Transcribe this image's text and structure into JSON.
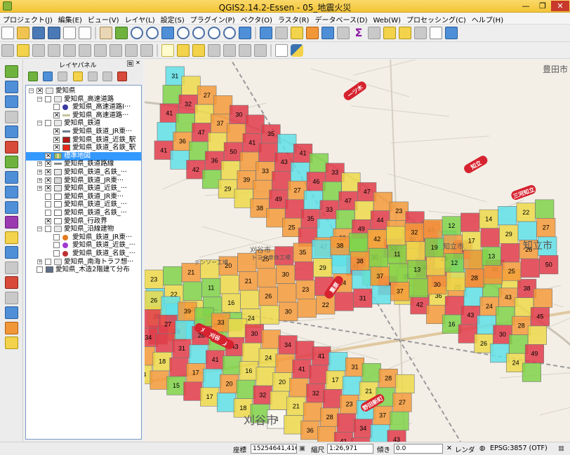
{
  "window": {
    "title": "QGIS2.14.2-Essen - 05_地震火災",
    "minimize": "—",
    "maximize": "❐",
    "close": "✕"
  },
  "menu": [
    "プロジェクト(J)",
    "編集(E)",
    "ビュー(V)",
    "レイヤ(L)",
    "設定(S)",
    "プラグイン(P)",
    "ベクタ(O)",
    "ラスタ(R)",
    "データベース(D)",
    "Web(W)",
    "プロセッシング(C)",
    "ヘルプ(H)"
  ],
  "layer_panel": {
    "title": "レイヤパネル",
    "float_glyph": "⧉",
    "close_glyph": "✕"
  },
  "layers": [
    {
      "label": "愛知県",
      "expand": "−",
      "checked": true
    },
    {
      "label": "愛知県_高速道路",
      "expand": "−",
      "checked": false
    },
    {
      "label": "愛知県_高速道路I···",
      "checked": false
    },
    {
      "label": "愛知県_高速道路···",
      "checked": true
    },
    {
      "label": "愛知県_鉄道",
      "expand": "−",
      "checked": false
    },
    {
      "label": "愛知県_鉄道_JR東···",
      "checked": true
    },
    {
      "label": "愛知県_鉄道_近鉄_駅",
      "checked": true
    },
    {
      "label": "愛知県_鉄道_名鉄_駅",
      "checked": true
    },
    {
      "label": "標準地図",
      "checked": true
    },
    {
      "label": "愛知県_鉄道路線",
      "expand": "+",
      "checked": true
    },
    {
      "label": "愛知県_鉄道_名鉄_···",
      "expand": "+",
      "checked": true
    },
    {
      "label": "愛知県_鉄道_JR東···",
      "expand": "+",
      "checked": true
    },
    {
      "label": "愛知県_鉄道_近鉄_···",
      "expand": "+",
      "checked": true
    },
    {
      "label": "愛知県_鉄道_JR東···",
      "checked": false
    },
    {
      "label": "愛知県_鉄道_近鉄_···",
      "checked": false
    },
    {
      "label": "愛知県_鉄道_名鉄_···",
      "checked": false
    },
    {
      "label": "愛知県_行政界",
      "checked": true
    },
    {
      "label": "愛知県_沿線建物",
      "expand": "−",
      "checked": false
    },
    {
      "label": "愛知県_鉄道_JR東···",
      "checked": false
    },
    {
      "label": "愛知県_鉄道_近鉄_···",
      "checked": false
    },
    {
      "label": "愛知県_鉄道_名鉄_···",
      "checked": false
    },
    {
      "label": "愛知県_南海トラフ想···",
      "expand": "+",
      "checked": false
    },
    {
      "label": "愛知県_木造2階建て分布",
      "checked": false
    }
  ],
  "colors": {
    "selection": "#3399ff",
    "class_red": "#e03c4a",
    "class_orange": "#f39a3a",
    "class_yellow": "#ecd94a",
    "class_green": "#7fd24a",
    "class_cyan": "#5fe0e8",
    "class_white": "#f7f7f0"
  },
  "icons": {
    "toolbar": [
      "new-project-icon",
      "open-project-icon",
      "save-project-icon",
      "save-as-icon",
      "print-composer-icon",
      "composer-manager-icon",
      "pan-map-icon",
      "pan-to-selection-icon",
      "zoom-in-icon",
      "zoom-out-icon",
      "zoom-full-icon",
      "zoom-to-selection-icon",
      "zoom-to-layer-icon",
      "zoom-native-icon",
      "refresh-icon",
      "identify-icon",
      "measure-icon",
      "select-features-icon",
      "deselect-icon",
      "attribute-table-icon",
      "field-calculator-icon",
      "statistics-icon",
      "measure-line-icon",
      "map-tips-icon",
      "new-bookmark-icon",
      "show-bookmarks-icon",
      "text-annotation-icon",
      "help-icon"
    ],
    "toolbar2": [
      "digitize-icon",
      "edit-pencil-icon",
      "save-edits-icon",
      "add-feature-icon",
      "node-tool-icon",
      "move-feature-icon",
      "delete-selected-icon",
      "cut-features-icon",
      "copy-features-icon",
      "paste-features-icon",
      "label-abc-icon",
      "pin-labels-icon",
      "show-hide-labels-icon",
      "move-label-icon",
      "rotate-label-icon",
      "change-label-icon",
      "csw-icon",
      "python-console-icon"
    ],
    "left": [
      "add-vector-layer-icon",
      "add-raster-layer-icon",
      "add-postgis-layer-icon",
      "add-spatialite-layer-icon",
      "add-mssql-layer-icon",
      "add-oracle-layer-icon",
      "add-db2-layer-icon",
      "add-wms-layer-icon",
      "add-wcs-layer-icon",
      "add-wfs-layer-icon",
      "add-delimited-text-icon",
      "new-shapefile-icon",
      "new-spatialite-icon",
      "new-temporary-layer-icon",
      "gps-icon",
      "georeferencer-icon",
      "raster-calculator-icon",
      "heatmap-icon",
      "coordinate-capture-icon"
    ]
  },
  "map": {
    "place_labels": [
      "豊田市",
      "刈谷市",
      "知立市",
      "知立市",
      "刈谷市",
      "デンソー工場",
      "トヨタ車体工場"
    ],
    "station_labels": [
      "一ツ木",
      "知立",
      "三河知立",
      "重原",
      "刈谷",
      "刈谷",
      "刈谷",
      "野田新町"
    ],
    "numbered_cells": [
      {
        "v": "31",
        "c": "cyan"
      },
      {
        "v": "27",
        "c": "orange"
      },
      {
        "v": "30",
        "c": "red"
      },
      {
        "v": "35",
        "c": "red"
      },
      {
        "v": "41",
        "c": "red"
      },
      {
        "v": "33",
        "c": "red"
      },
      {
        "v": "47",
        "c": "red"
      },
      {
        "v": "23",
        "c": "orange"
      },
      {
        "v": "43",
        "c": "red"
      },
      {
        "v": "54",
        "c": "red"
      },
      {
        "v": "36",
        "c": "red"
      },
      {
        "v": "38",
        "c": "red"
      },
      {
        "v": "32",
        "c": "red"
      },
      {
        "v": "37",
        "c": "orange"
      },
      {
        "v": "41",
        "c": "red"
      },
      {
        "v": "43",
        "c": "red"
      },
      {
        "v": "46",
        "c": "red"
      },
      {
        "v": "47",
        "c": "red"
      },
      {
        "v": "44",
        "c": "red"
      },
      {
        "v": "30",
        "c": "orange"
      },
      {
        "v": "28",
        "c": "orange"
      },
      {
        "v": "32",
        "c": "red"
      },
      {
        "v": "43",
        "c": "orange"
      },
      {
        "v": "45",
        "c": "red"
      },
      {
        "v": "41",
        "c": "red"
      },
      {
        "v": "47",
        "c": "red"
      },
      {
        "v": "50",
        "c": "red"
      },
      {
        "v": "33",
        "c": "orange"
      },
      {
        "v": "27",
        "c": "orange"
      },
      {
        "v": "33",
        "c": "red"
      },
      {
        "v": "49",
        "c": "red"
      },
      {
        "v": "53",
        "c": "red"
      },
      {
        "v": "48",
        "c": "red"
      },
      {
        "v": "25",
        "c": "orange"
      },
      {
        "v": "24",
        "c": "orange"
      },
      {
        "v": "28",
        "c": "orange"
      },
      {
        "v": "36",
        "c": "orange"
      },
      {
        "v": "36",
        "c": "red"
      },
      {
        "v": "39",
        "c": "orange"
      },
      {
        "v": "49",
        "c": "red"
      },
      {
        "v": "35",
        "c": "red"
      },
      {
        "v": "29",
        "c": "orange"
      },
      {
        "v": "30",
        "c": "orange"
      },
      {
        "v": "35",
        "c": "yellow"
      },
      {
        "v": "36",
        "c": "yellow"
      },
      {
        "v": "43",
        "c": "red"
      },
      {
        "v": "30",
        "c": "red"
      },
      {
        "v": "49",
        "c": "red"
      },
      {
        "v": "41",
        "c": "red"
      },
      {
        "v": "42",
        "c": "red"
      },
      {
        "v": "29",
        "c": "yellow"
      },
      {
        "v": "38",
        "c": "orange"
      },
      {
        "v": "25",
        "c": "orange"
      },
      {
        "v": "47",
        "c": "orange"
      },
      {
        "v": "41",
        "c": "red"
      },
      {
        "v": "38",
        "c": "red"
      },
      {
        "v": "42",
        "c": "red"
      },
      {
        "v": "16",
        "c": "green"
      },
      {
        "v": "26",
        "c": "yellow"
      },
      {
        "v": "24",
        "c": "yellow"
      },
      {
        "v": "23",
        "c": "yellow"
      },
      {
        "v": "21",
        "c": "orange"
      },
      {
        "v": "20",
        "c": "orange"
      },
      {
        "v": "25",
        "c": "orange"
      },
      {
        "v": "35",
        "c": "orange"
      },
      {
        "v": "38",
        "c": "orange"
      },
      {
        "v": "42",
        "c": "orange"
      },
      {
        "v": "32",
        "c": "orange"
      },
      {
        "v": "12",
        "c": "green"
      },
      {
        "v": "14",
        "c": "yellow"
      },
      {
        "v": "22",
        "c": "yellow"
      },
      {
        "v": "22",
        "c": "yellow"
      },
      {
        "v": "11",
        "c": "green"
      },
      {
        "v": "21",
        "c": "orange"
      },
      {
        "v": "30",
        "c": "orange"
      },
      {
        "v": "29",
        "c": "yellow"
      },
      {
        "v": "38",
        "c": "orange"
      },
      {
        "v": "11",
        "c": "green"
      },
      {
        "v": "19",
        "c": "green"
      },
      {
        "v": "17",
        "c": "yellow"
      },
      {
        "v": "29",
        "c": "yellow"
      },
      {
        "v": "27",
        "c": "orange"
      },
      {
        "v": "20",
        "c": "yellow"
      },
      {
        "v": "24",
        "c": "yellow"
      },
      {
        "v": "16",
        "c": "yellow"
      },
      {
        "v": "26",
        "c": "orange"
      },
      {
        "v": "23",
        "c": "orange"
      },
      {
        "v": "24",
        "c": "orange"
      },
      {
        "v": "37",
        "c": "orange"
      },
      {
        "v": "13",
        "c": "green"
      },
      {
        "v": "12",
        "c": "green"
      },
      {
        "v": "13",
        "c": "green"
      },
      {
        "v": "26",
        "c": "orange"
      },
      {
        "v": "28",
        "c": "orange"
      },
      {
        "v": "26",
        "c": "orange"
      },
      {
        "v": "24",
        "c": "yellow"
      },
      {
        "v": "30",
        "c": "orange"
      },
      {
        "v": "22",
        "c": "orange"
      },
      {
        "v": "31",
        "c": "red"
      },
      {
        "v": "37",
        "c": "orange"
      },
      {
        "v": "30",
        "c": "orange"
      },
      {
        "v": "28",
        "c": "orange"
      },
      {
        "v": "25",
        "c": "orange"
      },
      {
        "v": "50",
        "c": "red"
      },
      {
        "v": "26",
        "c": "yellow"
      },
      {
        "v": "39",
        "c": "orange"
      },
      {
        "v": "33",
        "c": "orange"
      },
      {
        "v": "30",
        "c": "red"
      },
      {
        "v": "34",
        "c": "red"
      },
      {
        "v": "41",
        "c": "red"
      },
      {
        "v": "31",
        "c": "orange"
      },
      {
        "v": "28",
        "c": "orange"
      },
      {
        "v": "27",
        "c": "red"
      },
      {
        "v": "28",
        "c": "red"
      },
      {
        "v": "43",
        "c": "red"
      },
      {
        "v": "24",
        "c": "yellow"
      },
      {
        "v": "41",
        "c": "red"
      },
      {
        "v": "17",
        "c": "yellow"
      },
      {
        "v": "21",
        "c": "yellow"
      },
      {
        "v": "27",
        "c": "orange"
      },
      {
        "v": "34",
        "c": "red"
      },
      {
        "v": "31",
        "c": "red"
      },
      {
        "v": "41",
        "c": "red"
      },
      {
        "v": "16",
        "c": "yellow"
      },
      {
        "v": "20",
        "c": "yellow"
      },
      {
        "v": "32",
        "c": "red"
      },
      {
        "v": "23",
        "c": "orange"
      },
      {
        "v": "37",
        "c": "orange"
      },
      {
        "v": "18",
        "c": "yellow"
      },
      {
        "v": "17",
        "c": "orange"
      },
      {
        "v": "20",
        "c": "orange"
      },
      {
        "v": "32",
        "c": "red"
      },
      {
        "v": "21",
        "c": "yellow"
      },
      {
        "v": "28",
        "c": "orange"
      },
      {
        "v": "34",
        "c": "red"
      },
      {
        "v": "43",
        "c": "red"
      },
      {
        "v": "14",
        "c": "yellow"
      },
      {
        "v": "15",
        "c": "green"
      },
      {
        "v": "17",
        "c": "yellow"
      },
      {
        "v": "18",
        "c": "yellow"
      },
      {
        "v": "4",
        "c": "white"
      },
      {
        "v": "36",
        "c": "orange"
      },
      {
        "v": "41",
        "c": "red"
      },
      {
        "v": "15",
        "c": "yellow"
      },
      {
        "v": "16",
        "c": "green"
      },
      {
        "v": "15",
        "c": "yellow"
      },
      {
        "v": "30",
        "c": "orange"
      },
      {
        "v": "41",
        "c": "orange"
      },
      {
        "v": "43",
        "c": "red"
      },
      {
        "v": "32",
        "c": "red"
      },
      {
        "v": "36",
        "c": "orange"
      },
      {
        "v": "32",
        "c": "red"
      },
      {
        "v": "33",
        "c": "red"
      },
      {
        "v": "36",
        "c": "orange"
      },
      {
        "v": "38",
        "c": "red"
      },
      {
        "v": "29",
        "c": "orange"
      },
      {
        "v": "30",
        "c": "orange"
      },
      {
        "v": "30",
        "c": "orange"
      },
      {
        "v": "20",
        "c": "yellow"
      },
      {
        "v": "36",
        "c": "orange"
      },
      {
        "v": "31",
        "c": "orange"
      },
      {
        "v": "30",
        "c": "orange"
      }
    ]
  },
  "status": {
    "coord_label": "座標",
    "coord_value": "15254641,4166115",
    "scale_label": "縮尺",
    "scale_value": "1:26,971",
    "rotation_label": "傾き",
    "rotation_value": "0.0",
    "render_label": "レンダ",
    "crs": "EPSG:3857 (OTF)"
  }
}
